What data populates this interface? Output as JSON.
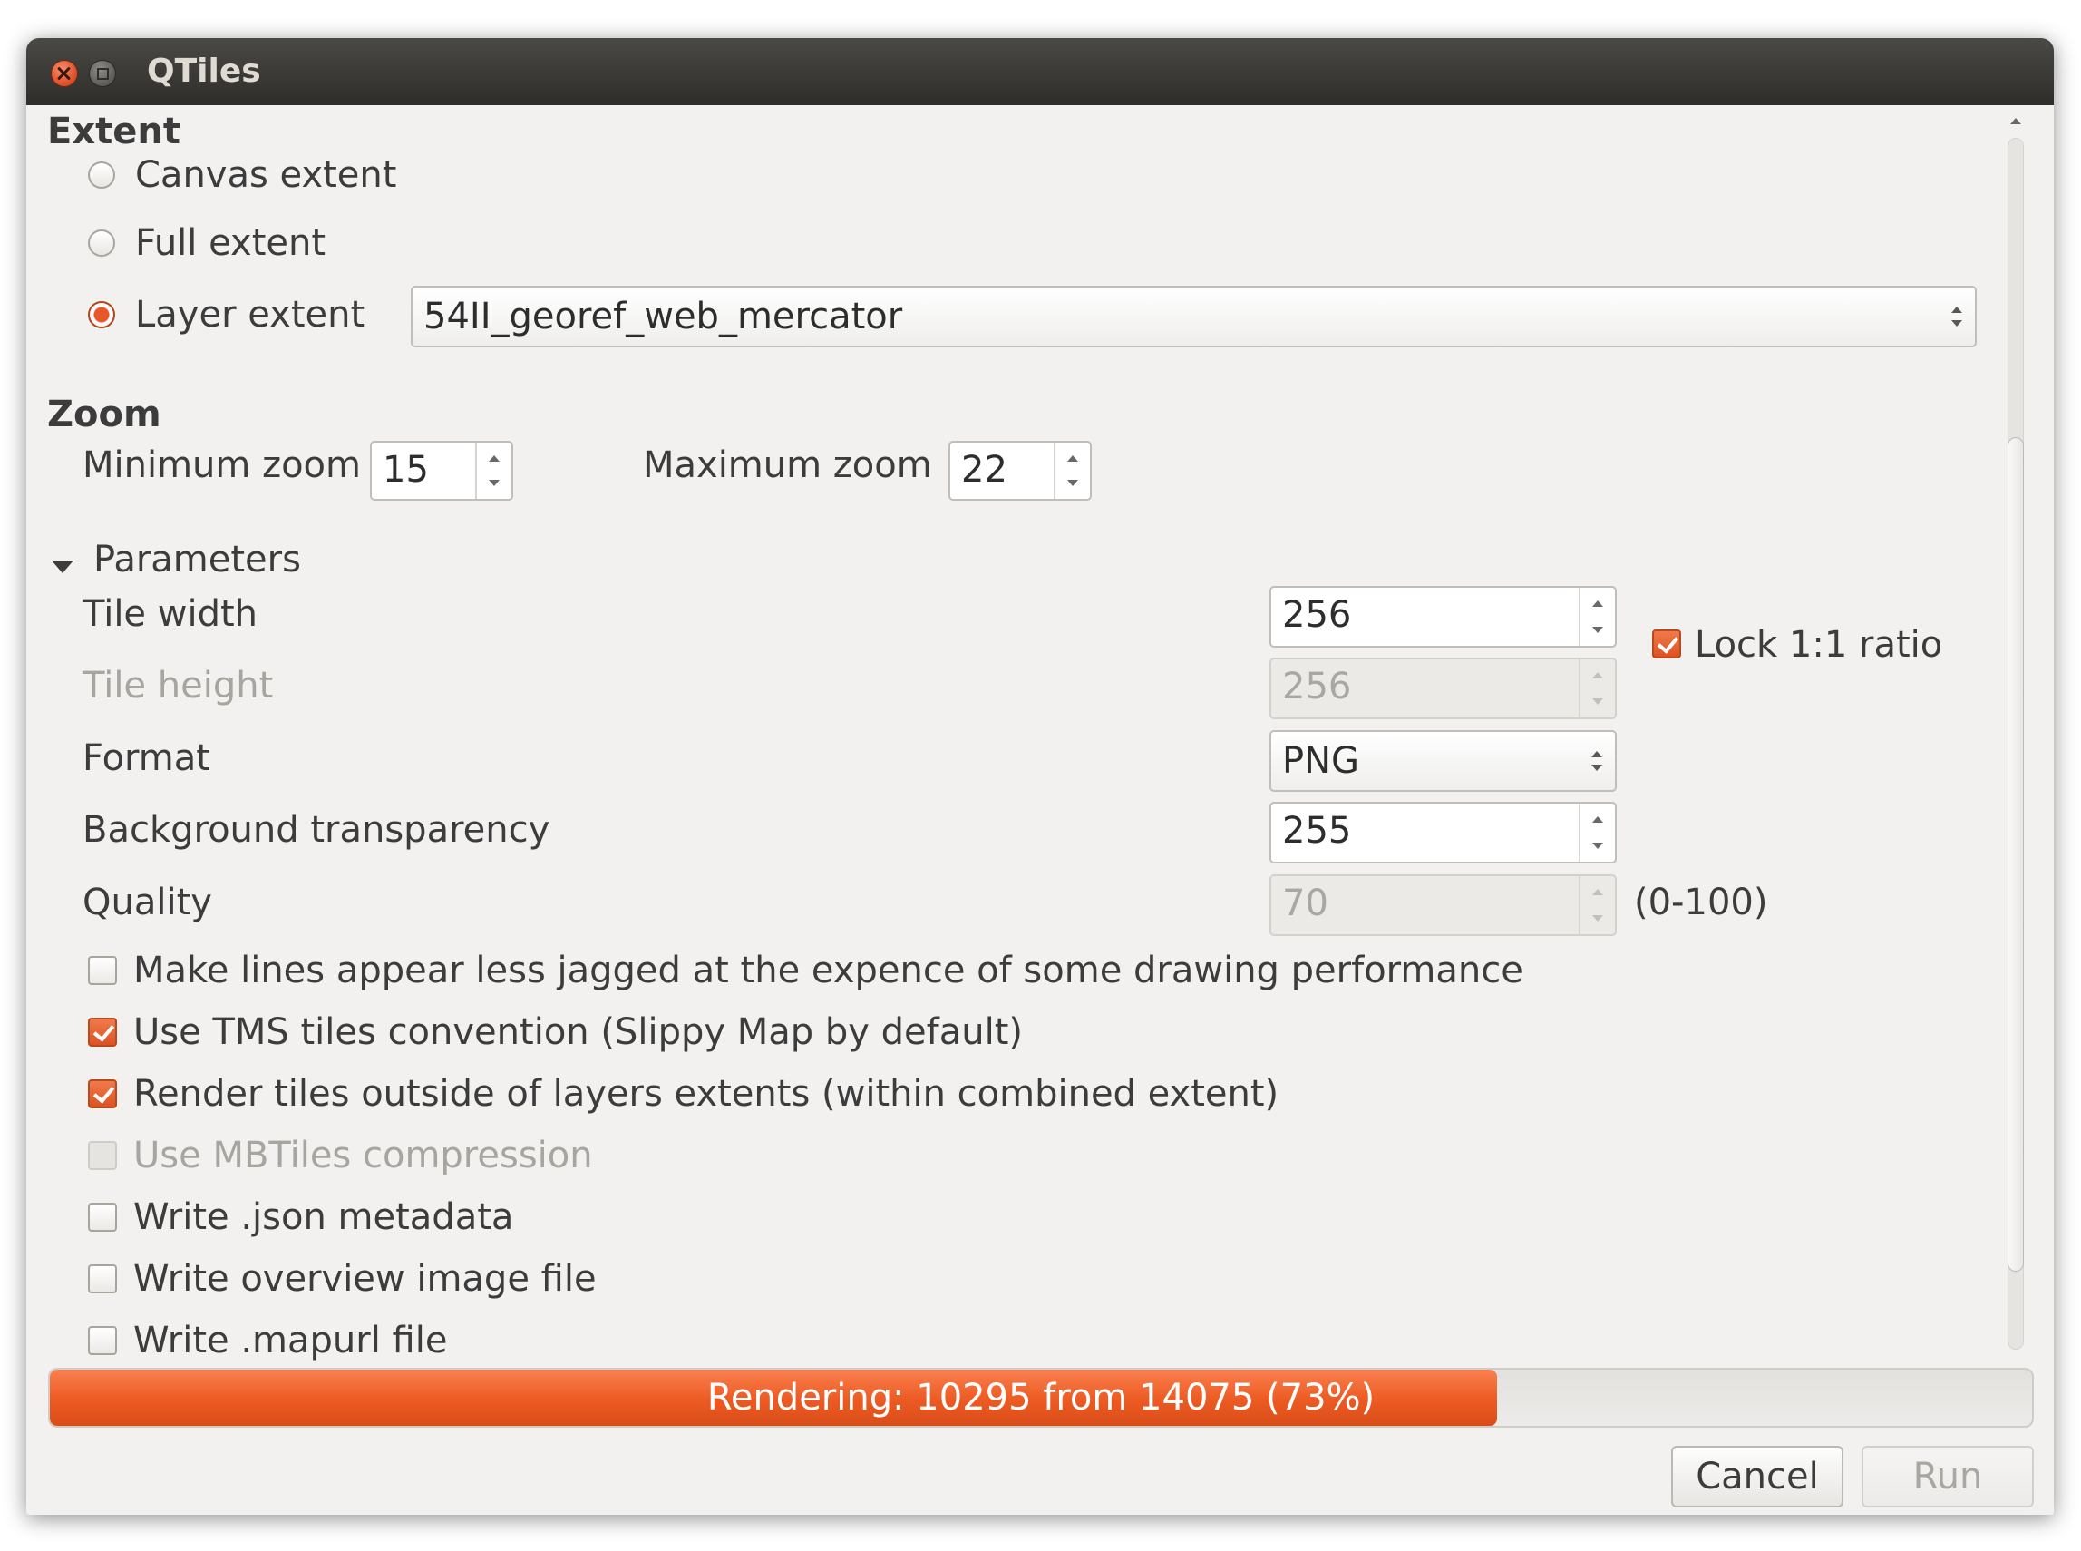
{
  "window": {
    "title": "QTiles"
  },
  "extent": {
    "heading": "Extent",
    "canvas_label": "Canvas extent",
    "full_label": "Full extent",
    "layer_label": "Layer extent",
    "selected": "layer",
    "layer_value": "54II_georef_web_mercator"
  },
  "zoom": {
    "heading": "Zoom",
    "min_label": "Minimum zoom",
    "min_value": "15",
    "max_label": "Maximum zoom",
    "max_value": "22"
  },
  "parameters": {
    "heading": "Parameters",
    "tile_width_label": "Tile width",
    "tile_width_value": "256",
    "tile_height_label": "Tile height",
    "tile_height_value": "256",
    "lock_ratio_label": "Lock 1:1 ratio",
    "lock_ratio_checked": true,
    "format_label": "Format",
    "format_value": "PNG",
    "transparency_label": "Background transparency",
    "transparency_value": "255",
    "quality_label": "Quality",
    "quality_value": "70",
    "quality_hint": "(0-100)"
  },
  "options": [
    {
      "label": "Make lines appear less jagged at the expence of some drawing performance",
      "checked": false,
      "enabled": true
    },
    {
      "label": "Use TMS tiles convention (Slippy Map by default)",
      "checked": true,
      "enabled": true
    },
    {
      "label": "Render tiles outside of layers extents (within combined extent)",
      "checked": true,
      "enabled": true
    },
    {
      "label": "Use MBTiles compression",
      "checked": false,
      "enabled": false
    },
    {
      "label": "Write .json metadata",
      "checked": false,
      "enabled": true
    },
    {
      "label": "Write overview image file",
      "checked": false,
      "enabled": true
    },
    {
      "label": "Write .mapurl file",
      "checked": false,
      "enabled": true
    }
  ],
  "progress": {
    "text": "Rendering: 10295 from 14075 (73%)",
    "percent": 73
  },
  "buttons": {
    "cancel": "Cancel",
    "run": "Run"
  },
  "colors": {
    "accent": "#e8572a",
    "titlebar": "#3c3b37",
    "background": "#f2f1f0"
  }
}
